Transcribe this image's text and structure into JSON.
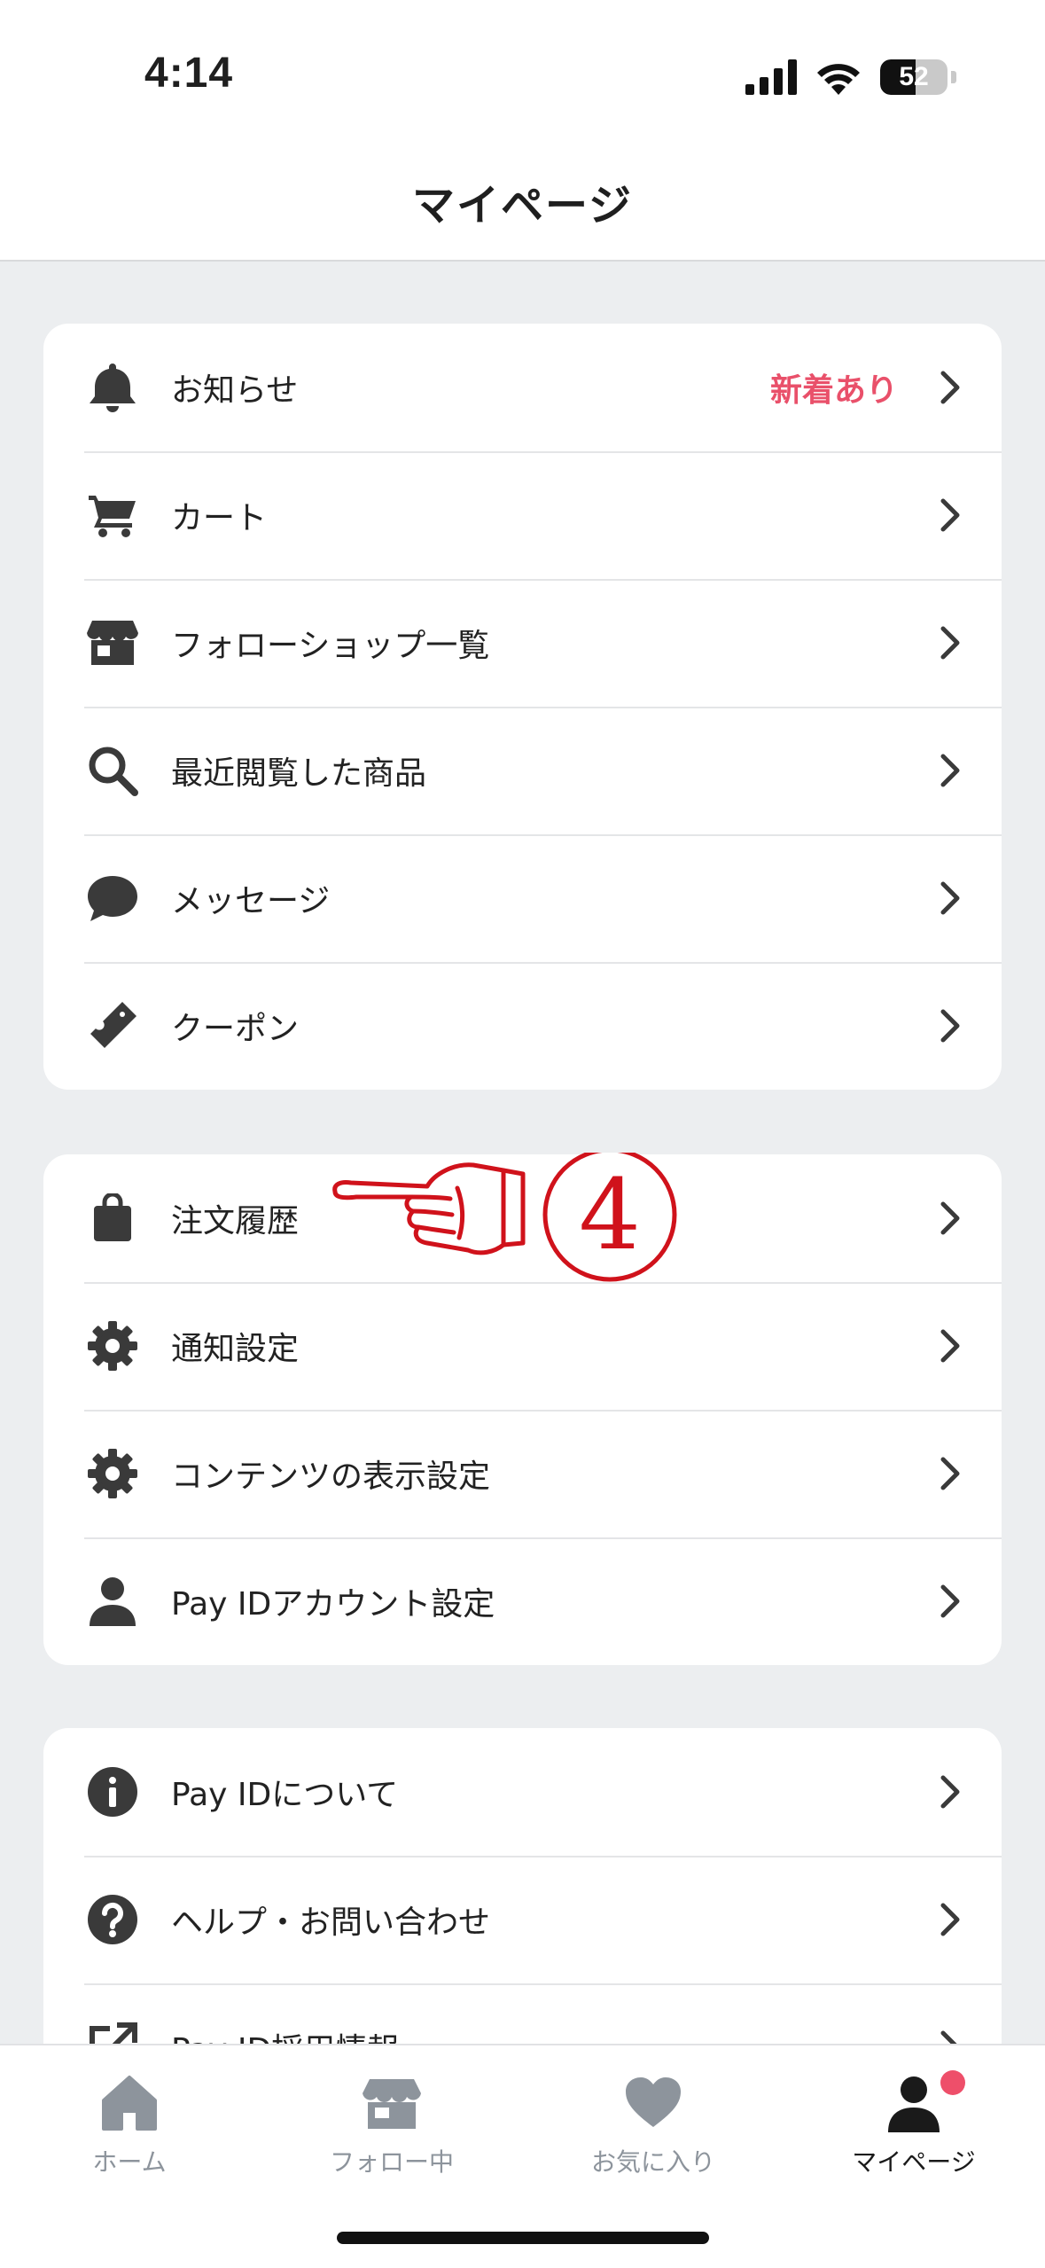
{
  "status_bar": {
    "time": "4:14",
    "battery": "52",
    "battery_level": 0.52
  },
  "header": {
    "title": "マイページ"
  },
  "section1": [
    {
      "label": "お知らせ",
      "badge": "新着あり",
      "icon": "bell-icon"
    },
    {
      "label": "カート",
      "icon": "cart-icon"
    },
    {
      "label": "フォローショップ一覧",
      "icon": "store-icon"
    },
    {
      "label": "最近閲覧した商品",
      "icon": "search-icon"
    },
    {
      "label": "メッセージ",
      "icon": "chat-bubble-icon"
    },
    {
      "label": "クーポン",
      "icon": "ticket-icon"
    }
  ],
  "section2": [
    {
      "label": "注文履歴",
      "icon": "shopping-bag-icon"
    },
    {
      "label": "通知設定",
      "icon": "gear-icon"
    },
    {
      "label": "コンテンツの表示設定",
      "icon": "gear-icon"
    },
    {
      "label": "Pay IDアカウント設定",
      "icon": "person-icon"
    }
  ],
  "section3": [
    {
      "label": "Pay IDについて",
      "icon": "info-icon"
    },
    {
      "label": "ヘルプ・お問い合わせ",
      "icon": "help-icon"
    },
    {
      "label": "Pay ID採用情報",
      "icon": "external-link-icon"
    }
  ],
  "annotation": {
    "marker": "④"
  },
  "tabbar": {
    "tabs": [
      {
        "label": "ホーム",
        "icon": "home-icon"
      },
      {
        "label": "フォロー中",
        "icon": "store-icon"
      },
      {
        "label": "お気に入り",
        "icon": "heart-icon"
      },
      {
        "label": "マイページ",
        "icon": "person-icon",
        "active": true
      }
    ]
  },
  "colors": {
    "accent": "#e9506a",
    "icon": "#3a3a3a",
    "annotation_red": "#d0121b",
    "background": "#eceef0"
  }
}
